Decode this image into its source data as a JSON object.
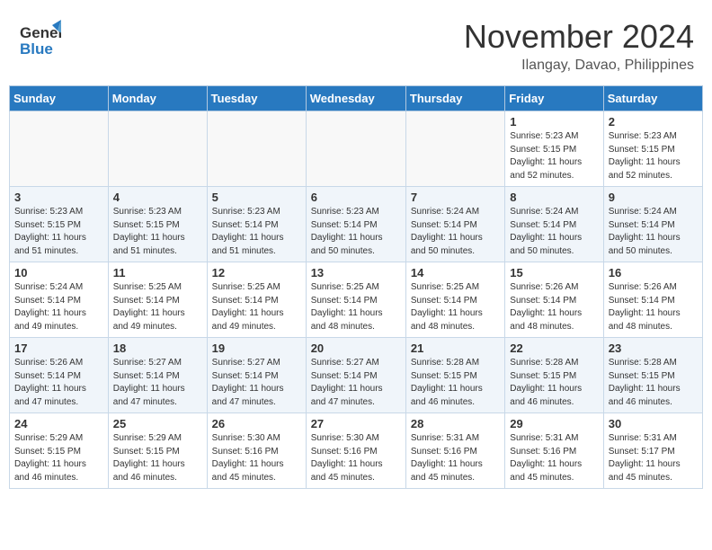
{
  "header": {
    "logo_line1": "General",
    "logo_line2": "Blue",
    "month_title": "November 2024",
    "location": "Ilangay, Davao, Philippines"
  },
  "weekdays": [
    "Sunday",
    "Monday",
    "Tuesday",
    "Wednesday",
    "Thursday",
    "Friday",
    "Saturday"
  ],
  "weeks": [
    [
      {
        "day": "",
        "info": ""
      },
      {
        "day": "",
        "info": ""
      },
      {
        "day": "",
        "info": ""
      },
      {
        "day": "",
        "info": ""
      },
      {
        "day": "",
        "info": ""
      },
      {
        "day": "1",
        "info": "Sunrise: 5:23 AM\nSunset: 5:15 PM\nDaylight: 11 hours\nand 52 minutes."
      },
      {
        "day": "2",
        "info": "Sunrise: 5:23 AM\nSunset: 5:15 PM\nDaylight: 11 hours\nand 52 minutes."
      }
    ],
    [
      {
        "day": "3",
        "info": "Sunrise: 5:23 AM\nSunset: 5:15 PM\nDaylight: 11 hours\nand 51 minutes."
      },
      {
        "day": "4",
        "info": "Sunrise: 5:23 AM\nSunset: 5:15 PM\nDaylight: 11 hours\nand 51 minutes."
      },
      {
        "day": "5",
        "info": "Sunrise: 5:23 AM\nSunset: 5:14 PM\nDaylight: 11 hours\nand 51 minutes."
      },
      {
        "day": "6",
        "info": "Sunrise: 5:23 AM\nSunset: 5:14 PM\nDaylight: 11 hours\nand 50 minutes."
      },
      {
        "day": "7",
        "info": "Sunrise: 5:24 AM\nSunset: 5:14 PM\nDaylight: 11 hours\nand 50 minutes."
      },
      {
        "day": "8",
        "info": "Sunrise: 5:24 AM\nSunset: 5:14 PM\nDaylight: 11 hours\nand 50 minutes."
      },
      {
        "day": "9",
        "info": "Sunrise: 5:24 AM\nSunset: 5:14 PM\nDaylight: 11 hours\nand 50 minutes."
      }
    ],
    [
      {
        "day": "10",
        "info": "Sunrise: 5:24 AM\nSunset: 5:14 PM\nDaylight: 11 hours\nand 49 minutes."
      },
      {
        "day": "11",
        "info": "Sunrise: 5:25 AM\nSunset: 5:14 PM\nDaylight: 11 hours\nand 49 minutes."
      },
      {
        "day": "12",
        "info": "Sunrise: 5:25 AM\nSunset: 5:14 PM\nDaylight: 11 hours\nand 49 minutes."
      },
      {
        "day": "13",
        "info": "Sunrise: 5:25 AM\nSunset: 5:14 PM\nDaylight: 11 hours\nand 48 minutes."
      },
      {
        "day": "14",
        "info": "Sunrise: 5:25 AM\nSunset: 5:14 PM\nDaylight: 11 hours\nand 48 minutes."
      },
      {
        "day": "15",
        "info": "Sunrise: 5:26 AM\nSunset: 5:14 PM\nDaylight: 11 hours\nand 48 minutes."
      },
      {
        "day": "16",
        "info": "Sunrise: 5:26 AM\nSunset: 5:14 PM\nDaylight: 11 hours\nand 48 minutes."
      }
    ],
    [
      {
        "day": "17",
        "info": "Sunrise: 5:26 AM\nSunset: 5:14 PM\nDaylight: 11 hours\nand 47 minutes."
      },
      {
        "day": "18",
        "info": "Sunrise: 5:27 AM\nSunset: 5:14 PM\nDaylight: 11 hours\nand 47 minutes."
      },
      {
        "day": "19",
        "info": "Sunrise: 5:27 AM\nSunset: 5:14 PM\nDaylight: 11 hours\nand 47 minutes."
      },
      {
        "day": "20",
        "info": "Sunrise: 5:27 AM\nSunset: 5:14 PM\nDaylight: 11 hours\nand 47 minutes."
      },
      {
        "day": "21",
        "info": "Sunrise: 5:28 AM\nSunset: 5:15 PM\nDaylight: 11 hours\nand 46 minutes."
      },
      {
        "day": "22",
        "info": "Sunrise: 5:28 AM\nSunset: 5:15 PM\nDaylight: 11 hours\nand 46 minutes."
      },
      {
        "day": "23",
        "info": "Sunrise: 5:28 AM\nSunset: 5:15 PM\nDaylight: 11 hours\nand 46 minutes."
      }
    ],
    [
      {
        "day": "24",
        "info": "Sunrise: 5:29 AM\nSunset: 5:15 PM\nDaylight: 11 hours\nand 46 minutes."
      },
      {
        "day": "25",
        "info": "Sunrise: 5:29 AM\nSunset: 5:15 PM\nDaylight: 11 hours\nand 46 minutes."
      },
      {
        "day": "26",
        "info": "Sunrise: 5:30 AM\nSunset: 5:16 PM\nDaylight: 11 hours\nand 45 minutes."
      },
      {
        "day": "27",
        "info": "Sunrise: 5:30 AM\nSunset: 5:16 PM\nDaylight: 11 hours\nand 45 minutes."
      },
      {
        "day": "28",
        "info": "Sunrise: 5:31 AM\nSunset: 5:16 PM\nDaylight: 11 hours\nand 45 minutes."
      },
      {
        "day": "29",
        "info": "Sunrise: 5:31 AM\nSunset: 5:16 PM\nDaylight: 11 hours\nand 45 minutes."
      },
      {
        "day": "30",
        "info": "Sunrise: 5:31 AM\nSunset: 5:17 PM\nDaylight: 11 hours\nand 45 minutes."
      }
    ]
  ]
}
